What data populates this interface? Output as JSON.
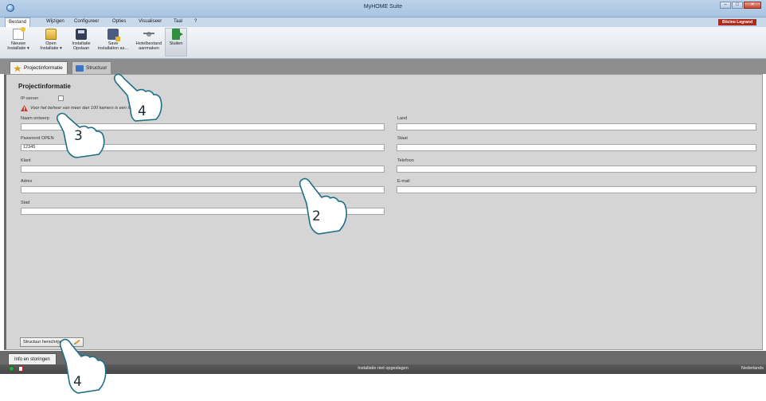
{
  "window": {
    "title": "MyHOME Suite",
    "buttons": [
      "–",
      "□",
      "✕"
    ]
  },
  "menu": {
    "items": [
      "Bestand",
      "Wijzigen",
      "Configureer",
      "Opties",
      "Visualiseer",
      "Taal",
      "?"
    ],
    "active": "Bestand",
    "brand": "Bticino Legrand"
  },
  "ribbon": {
    "buttons": [
      {
        "line1": "Nieuwe",
        "line2": "Installatie ▾",
        "icon": "new-document-icon"
      },
      {
        "line1": "Open",
        "line2": "Installatie ▾",
        "icon": "open-folder-icon"
      },
      {
        "line1": "Installatie",
        "line2": "Opslaan",
        "icon": "save-icon"
      },
      {
        "line1": "Save",
        "line2": "installation as...",
        "icon": "save-as-icon"
      },
      {
        "line1": "Hotelbestand",
        "line2": "aanmaken",
        "icon": "hotel-file-icon"
      },
      {
        "line1": "Sluiten",
        "line2": "",
        "icon": "exit-icon"
      }
    ]
  },
  "tabs": [
    {
      "label": "Projectinformatie",
      "icon": "star-icon"
    },
    {
      "label": "Structuur",
      "icon": "structure-icon"
    }
  ],
  "form": {
    "title": "Projectinformatie",
    "ip_server_label": "IP-server",
    "ip_server_checked": false,
    "warning": "Voor het beheer van meer dan 100 kamers is een IP-server nodig",
    "left_fields": [
      {
        "label": "Naam ontwerp",
        "value": ""
      },
      {
        "label": "Paswoord OPEN",
        "value": "12345"
      },
      {
        "label": "Klant",
        "value": ""
      },
      {
        "label": "Adres",
        "value": ""
      },
      {
        "label": "Stad",
        "value": ""
      }
    ],
    "right_fields": [
      {
        "label": "Land",
        "value": ""
      },
      {
        "label": "Staat",
        "value": ""
      },
      {
        "label": "Telefoon",
        "value": ""
      },
      {
        "label": "E-mail",
        "value": ""
      }
    ],
    "struct_button": "Structuur herschrijven"
  },
  "bottom": {
    "info_tab": "Info en storingen"
  },
  "status": {
    "text": "Installatie niet opgeslagen",
    "language": "Nederlands"
  },
  "callouts": [
    {
      "number": "4"
    },
    {
      "number": "3"
    },
    {
      "number": "2"
    },
    {
      "number": "4"
    }
  ],
  "colors": {
    "callout_fill": "#ffffff",
    "callout_stroke": "#1e6f86",
    "panel_bg": "#d5d5d5",
    "brand_red": "#aa2b20"
  }
}
